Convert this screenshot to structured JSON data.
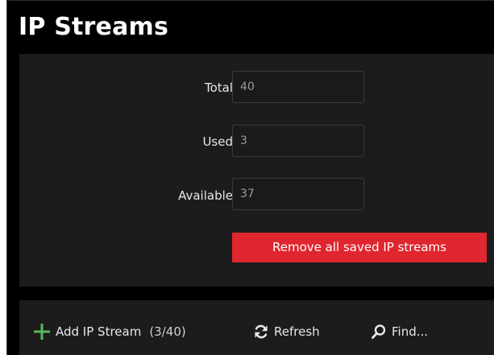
{
  "page": {
    "title": "IP Streams"
  },
  "stats": {
    "total_label": "Total",
    "total_value": "40",
    "used_label": "Used",
    "used_value": "3",
    "available_label": "Available",
    "available_value": "37"
  },
  "actions": {
    "remove_all_label": "Remove all saved IP streams"
  },
  "toolbar": {
    "add_label": "Add IP Stream",
    "add_count": "(3/40)",
    "refresh_label": "Refresh",
    "find_label": "Find..."
  },
  "colors": {
    "accent_red": "#e0262e",
    "add_icon_green": "#5cb85c",
    "background": "#000000",
    "panel": "#1c1c1c"
  },
  "icons": {
    "add": "plus-icon",
    "refresh": "refresh-icon",
    "find": "search-icon"
  }
}
